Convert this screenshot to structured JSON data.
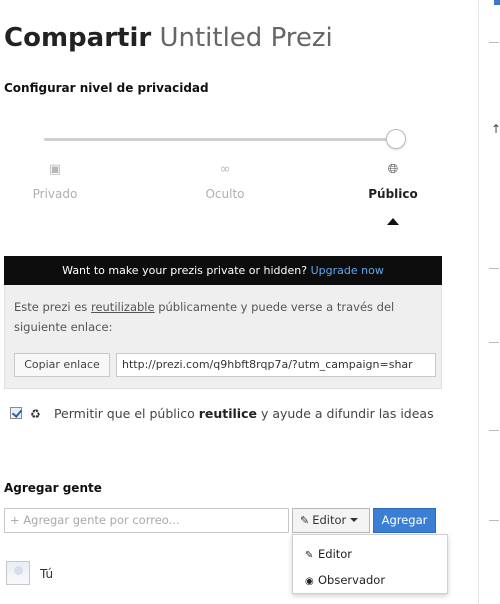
{
  "header": {
    "title_strong": "Compartir",
    "title_light": "Untitled Prezi"
  },
  "privacy": {
    "section_label": "Configurar nivel de privacidad",
    "options": [
      {
        "label": "Privado",
        "icon": "lock-icon"
      },
      {
        "label": "Oculto",
        "icon": "link-icon"
      },
      {
        "label": "Público",
        "icon": "globe-icon",
        "selected": true
      }
    ],
    "slider_value": "Público"
  },
  "upsell": {
    "text": "Want to make your prezis private or hidden?",
    "link": "Upgrade now"
  },
  "info": {
    "text_prefix": "Este prezi es ",
    "text_underlined": "reutilizable",
    "text_suffix": " públicamente y puede verse a través del siguiente enlace:",
    "copy_button": "Copiar enlace",
    "url": "http://prezi.com/q9hbft8rqp7a/?utm_campaign=shar"
  },
  "reuse": {
    "checked": true,
    "text_prefix": "Permitir que el público ",
    "text_bold": "reutilice",
    "text_suffix": " y ayude a difundir las ideas"
  },
  "add_people": {
    "section_label": "Agregar gente",
    "placeholder": "+ Agregar gente por correo...",
    "role_button": "Editor",
    "add_button": "Agregar",
    "dropdown": [
      {
        "label": "Editor",
        "icon": "pencil-icon"
      },
      {
        "label": "Observador",
        "icon": "eye-icon"
      }
    ]
  },
  "members": [
    {
      "name": "Tú"
    }
  ],
  "colors": {
    "accent_blue": "#3b7fd4",
    "upsell_bg": "#0d0d0d",
    "upsell_link": "#5fa8f0",
    "info_bg": "#efefef"
  }
}
